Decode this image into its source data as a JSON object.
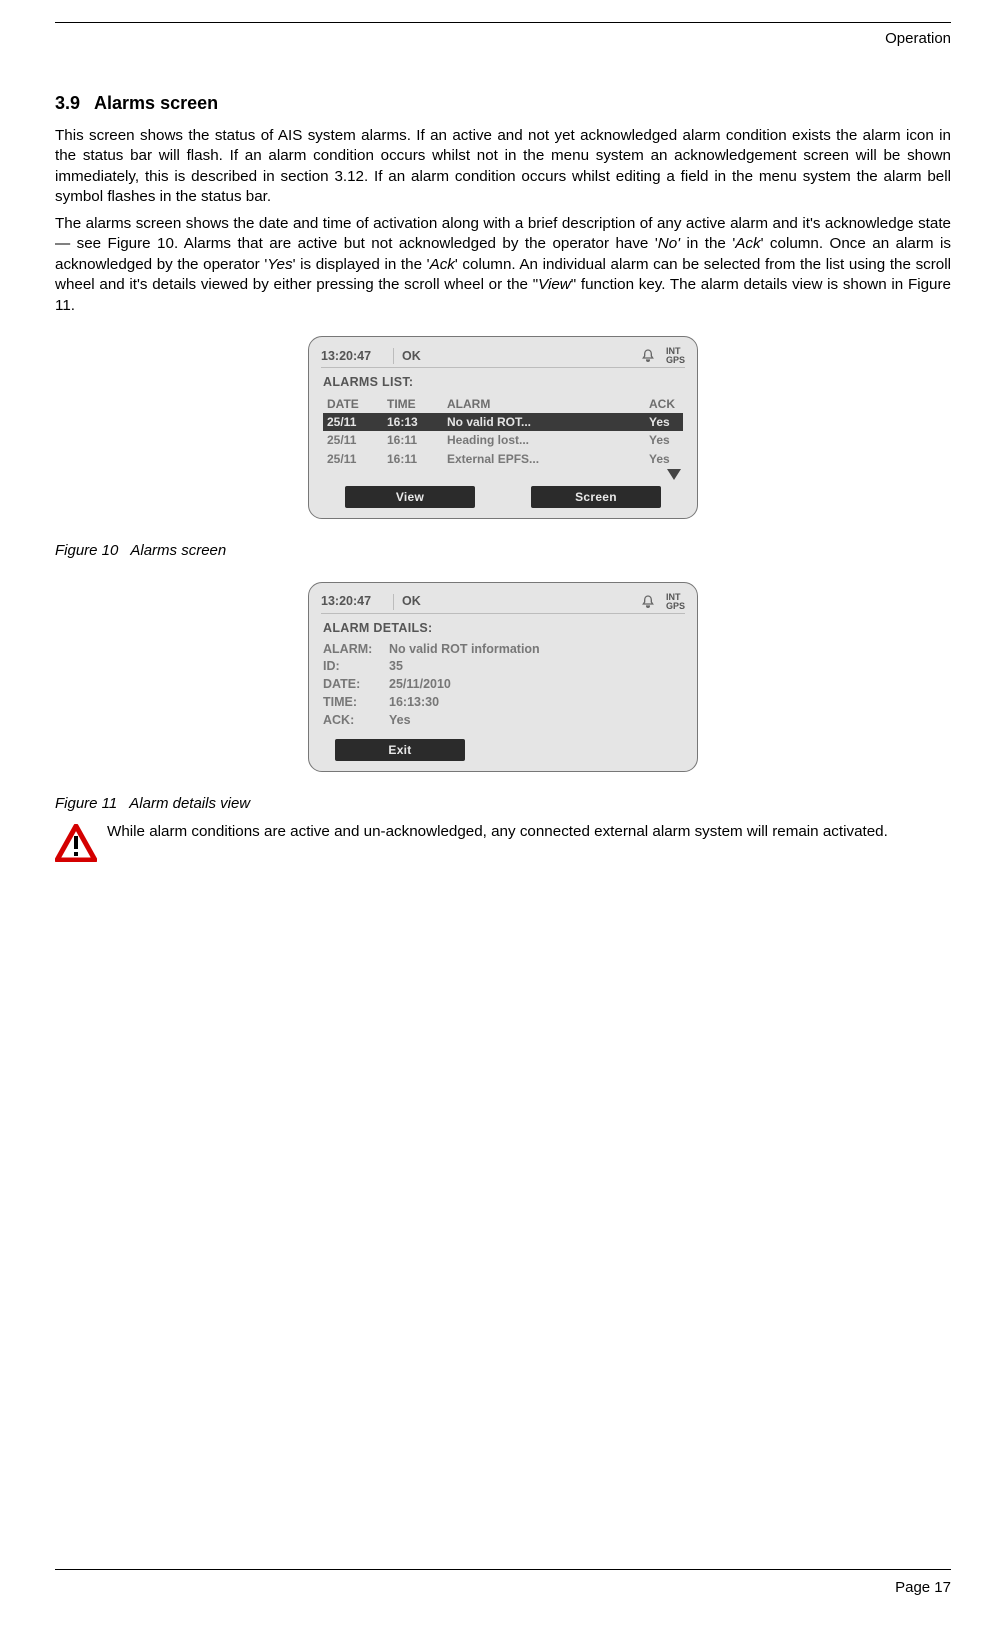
{
  "page": {
    "header_label": "Operation",
    "footer": "Page 17"
  },
  "section": {
    "number": "3.9",
    "title": "Alarms screen"
  },
  "para1_a": "This screen shows the status of AIS system alarms. If an active and not yet acknowledged alarm condition exists the alarm icon in the status bar will flash. If an alarm condition occurs whilst not in the menu system an acknowledgement screen will be shown immediately, this is described in section 3.12. If an alarm condition occurs whilst editing a field in the menu system the alarm bell symbol flashes in the status bar.",
  "para2_a": "The alarms screen shows the date and time of activation along with a brief description of any active alarm and it's acknowledge state — see Figure 10. Alarms that are active but not acknowledged by the operator have '",
  "para2_no": "No'",
  "para2_b": " in the '",
  "para2_ack1": "Ack",
  "para2_c": "' column. Once an alarm is acknowledged by the operator '",
  "para2_yes": "Yes",
  "para2_d": "' is displayed in the '",
  "para2_ack2": "Ack",
  "para2_e": "' column. An individual alarm can be selected from the list using the scroll wheel and it's details viewed by either pressing the scroll wheel or the \"",
  "para2_view": "View",
  "para2_f": "\" function key. The alarm details view is shown in Figure 11.",
  "fig10": {
    "caption_num": "Figure 10",
    "caption_text": "Alarms screen",
    "status": {
      "time": "13:20:47",
      "ok": "OK",
      "gps1": "INT",
      "gps2": "GPS"
    },
    "title": "ALARMS LIST:",
    "headers": {
      "date": "DATE",
      "time": "TIME",
      "alarm": "ALARM",
      "ack": "ACK"
    },
    "rows": [
      {
        "date": "25/11",
        "time": "16:13",
        "alarm": "No valid ROT...",
        "ack": "Yes",
        "selected": true
      },
      {
        "date": "25/11",
        "time": "16:11",
        "alarm": "Heading lost...",
        "ack": "Yes",
        "selected": false
      },
      {
        "date": "25/11",
        "time": "16:11",
        "alarm": "External EPFS...",
        "ack": "Yes",
        "selected": false
      }
    ],
    "fn": {
      "left": "View",
      "right": "Screen"
    }
  },
  "fig11": {
    "caption_num": "Figure 11",
    "caption_text": "Alarm details view",
    "status": {
      "time": "13:20:47",
      "ok": "OK",
      "gps1": "INT",
      "gps2": "GPS"
    },
    "title": "ALARM DETAILS:",
    "kv": {
      "k_alarm": "ALARM:",
      "v_alarm": "No valid ROT information",
      "k_id": "ID:",
      "v_id": "35",
      "k_date": "DATE:",
      "v_date": "25/11/2010",
      "k_time": "TIME:",
      "v_time": "16:13:30",
      "k_ack": "ACK:",
      "v_ack": "Yes"
    },
    "fn": {
      "left": "Exit"
    }
  },
  "warning": "While alarm conditions are active and un-acknowledged, any connected external alarm system will remain activated."
}
